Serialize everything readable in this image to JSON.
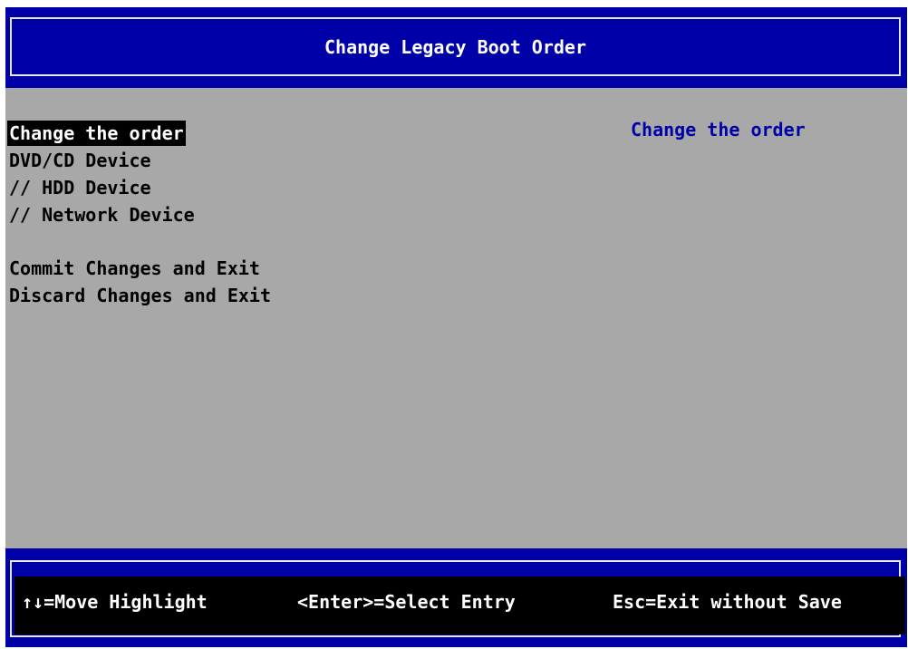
{
  "header": {
    "title": "Change Legacy Boot Order"
  },
  "menu": {
    "items": [
      {
        "label": "Change the order"
      },
      {
        "label": "DVD/CD Device"
      },
      {
        "label": "// HDD Device"
      },
      {
        "label": "// Network Device"
      },
      {
        "label": "Commit Changes and Exit"
      },
      {
        "label": "Discard Changes and Exit"
      }
    ],
    "selected_index": 0
  },
  "help": {
    "text": "Change the order"
  },
  "footer": {
    "hints": [
      {
        "label": "↑↓=Move Highlight"
      },
      {
        "label": "<Enter>=Select Entry"
      },
      {
        "label": "Esc=Exit without Save"
      }
    ]
  },
  "colors": {
    "header_bg": "#0000a8",
    "main_bg": "#a8a8a8",
    "help_text": "#0000a8",
    "selected_bg": "#000000"
  }
}
